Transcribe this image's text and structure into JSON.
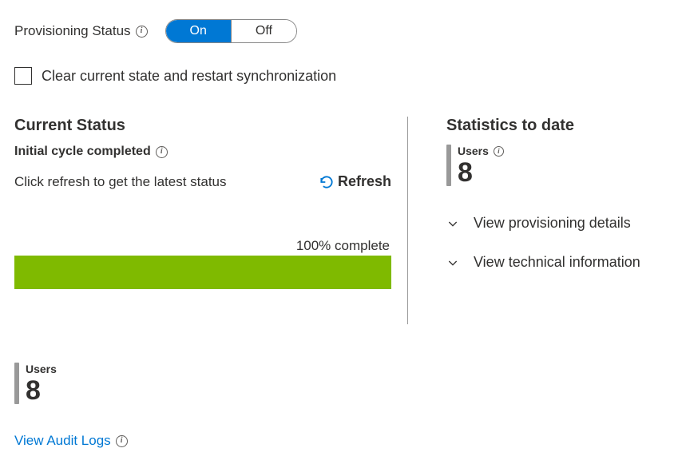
{
  "provisioning": {
    "label": "Provisioning Status",
    "on": "On",
    "off": "Off"
  },
  "checkbox": {
    "label": "Clear current state and restart synchronization"
  },
  "current_status": {
    "title": "Current Status",
    "subtitle": "Initial cycle completed",
    "help_text": "Click refresh to get the latest status",
    "refresh_label": "Refresh",
    "complete_text": "100% complete",
    "progress_pct": 100
  },
  "statistics": {
    "title": "Statistics to date",
    "users_label": "Users",
    "users_count": "8",
    "view_details": "View provisioning details",
    "view_technical": "View technical information"
  },
  "bottom": {
    "users_label": "Users",
    "users_count": "8",
    "audit_link": "View Audit Logs"
  }
}
